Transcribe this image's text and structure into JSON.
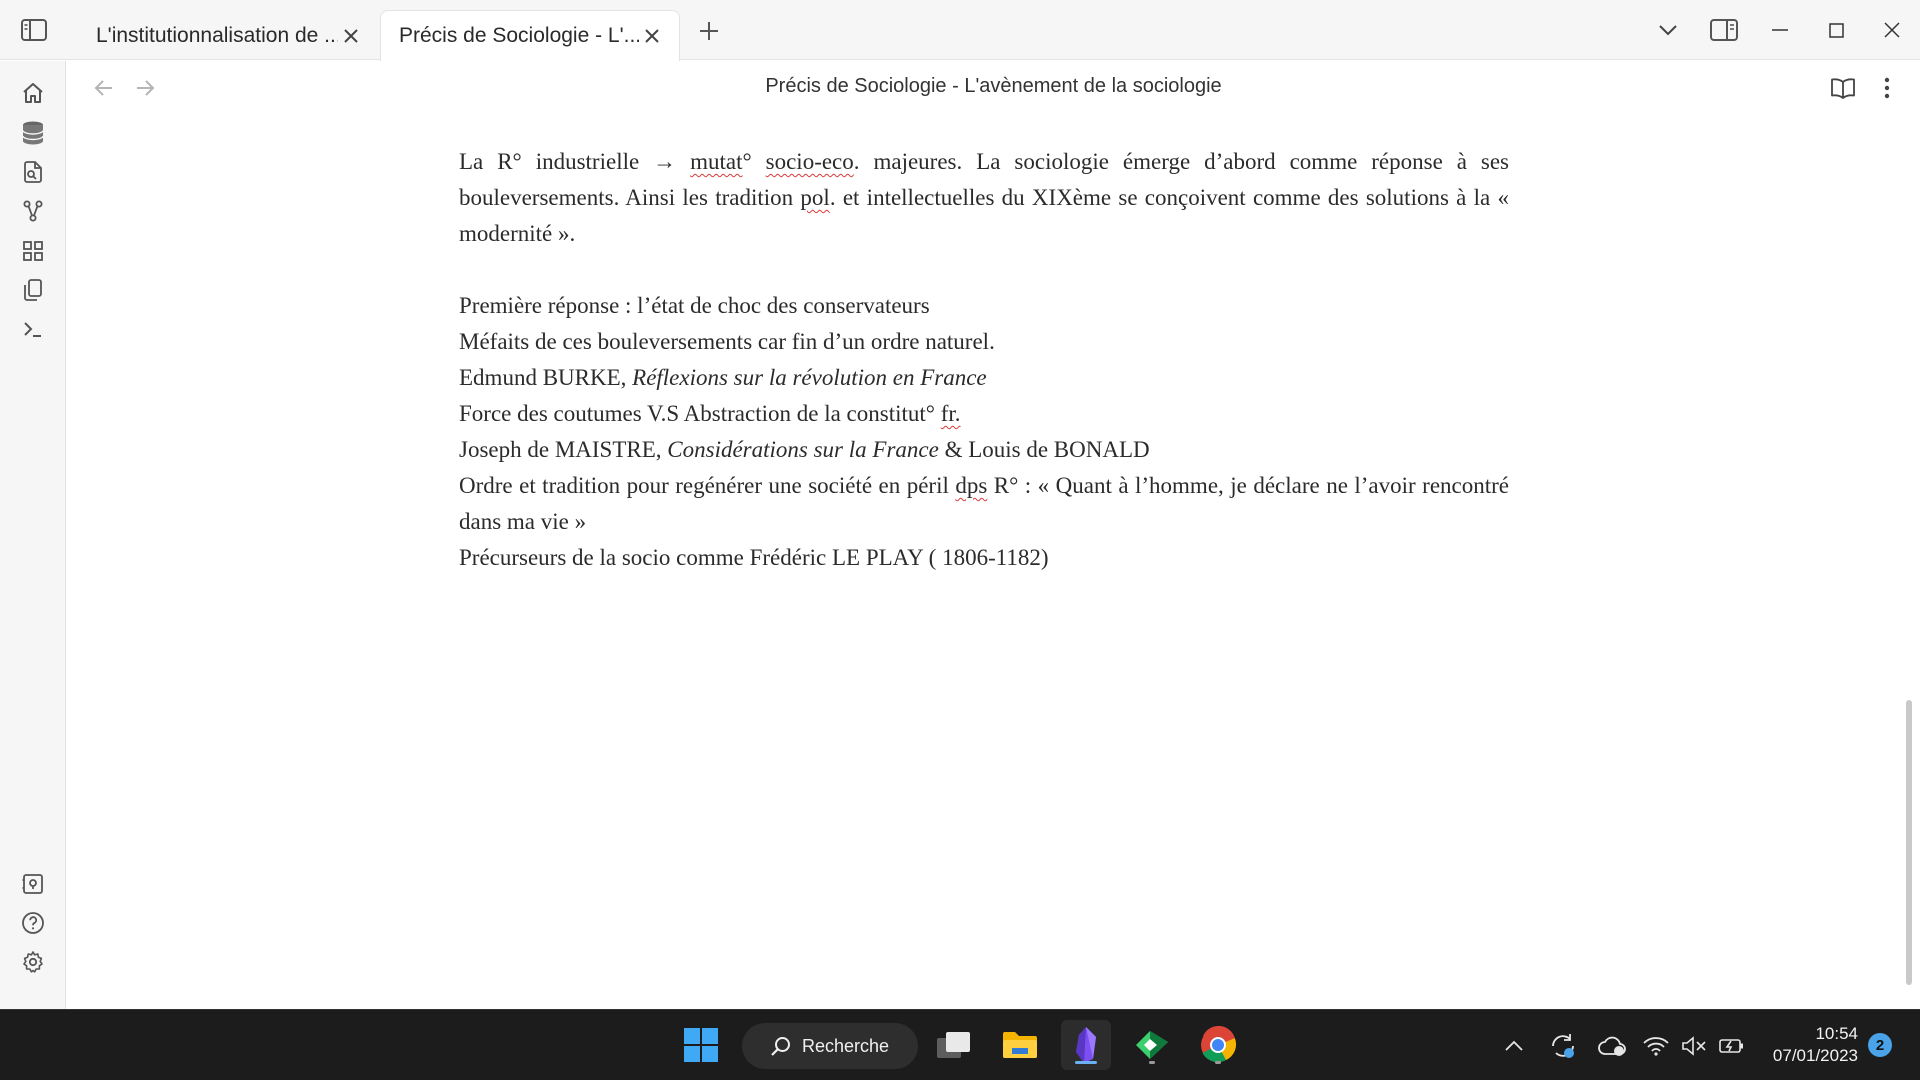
{
  "tabs": [
    {
      "label": "L'institutionnalisation de ...",
      "active": false
    },
    {
      "label": "Précis de Sociologie - L'...",
      "active": true
    }
  ],
  "view": {
    "title": "Précis de Sociologie - L'avènement de la sociologie"
  },
  "document": {
    "p1": {
      "a": "La R° industrielle → ",
      "s1": "mutat",
      "b": "° ",
      "s2": "socio-eco",
      "c": ". majeures. La sociologie émerge d’abord comme réponse à ses bouleversements. Ainsi les tradition ",
      "s3": "pol",
      "d": ". et intellectuelles du XIXème se conçoivent comme des solutions à la « modernité »."
    },
    "l1": "Première réponse : l’état de choc des conservateurs",
    "l2": "Méfaits de ces bouleversements car fin d’un ordre naturel.",
    "l3": {
      "a": "Edmund BURKE, ",
      "i": "Réflexions sur la révolution en France"
    },
    "l4": {
      "a": "Force des coutumes V.S Abstraction de la constitut° ",
      "s": "fr."
    },
    "l5": {
      "a": "Joseph de MAISTRE, ",
      "i": "Considérations sur la France",
      "b": " & Louis de BONALD"
    },
    "l6": {
      "a": "Ordre et tradition pour regénérer une société en péril ",
      "s": "dps",
      "b": " R° : « Quant à l’homme, je déclare ne l’avoir rencontré dans ma vie »"
    },
    "l7": "Précurseurs de la socio comme Frédéric LE PLAY ( 1806-1182)"
  },
  "taskbar": {
    "search_label": "Recherche",
    "time": "10:54",
    "date": "07/01/2023",
    "notification_count": "2"
  },
  "colors": {
    "accent": "#4aa3e8",
    "obsidian": "#7b4ff0",
    "spellcheck": "#d83a3a"
  },
  "icons": {
    "ribbon_top": [
      "home-icon",
      "database-icon",
      "file-search-icon",
      "graph-icon",
      "grid-icon",
      "pages-icon",
      "terminal-icon"
    ],
    "ribbon_bottom": [
      "vault-icon",
      "help-icon",
      "settings-icon"
    ]
  }
}
